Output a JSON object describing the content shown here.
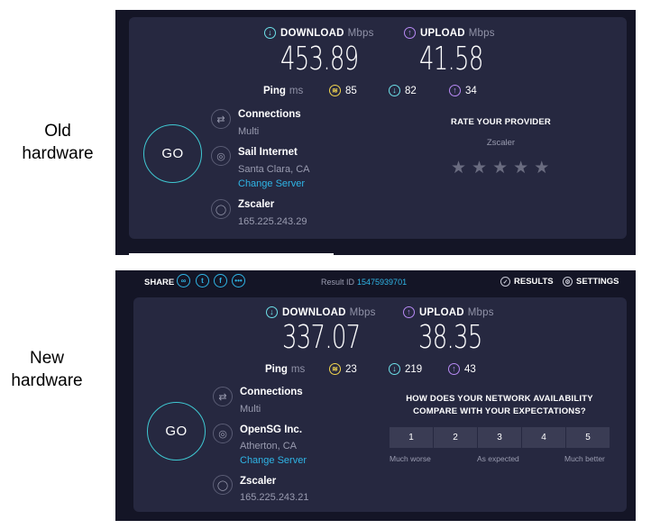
{
  "labels": {
    "old": [
      "Old",
      "hardware"
    ],
    "new": [
      "New",
      "hardware"
    ]
  },
  "colors": {
    "panel_bg": "#141526",
    "card_bg": "#262840",
    "download": "#6de0e8",
    "upload": "#b88af5",
    "jitter": "#f2d54e",
    "link": "#2fb5e6"
  },
  "old": {
    "download_label": "DOWNLOAD",
    "download_unit": "Mbps",
    "download_value": "453.89",
    "upload_label": "UPLOAD",
    "upload_unit": "Mbps",
    "upload_value": "41.58",
    "ping_label": "Ping",
    "ping_unit": "ms",
    "ping_jitter": "85",
    "ping_download": "82",
    "ping_upload": "34",
    "go_label": "GO",
    "connections_title": "Connections",
    "connections_value": "Multi",
    "server_name": "Sail Internet",
    "server_location": "Santa Clara, CA",
    "change_server": "Change Server",
    "isp_name": "Zscaler",
    "ip_address": "165.225.243.29",
    "rate_title": "RATE YOUR PROVIDER",
    "rate_provider": "Zscaler",
    "stars": 5
  },
  "new": {
    "share_label": "SHARE",
    "result_id_label": "Result ID",
    "result_id": "15475939701",
    "results_label": "RESULTS",
    "settings_label": "SETTINGS",
    "download_label": "DOWNLOAD",
    "download_unit": "Mbps",
    "download_value": "337.07",
    "upload_label": "UPLOAD",
    "upload_unit": "Mbps",
    "upload_value": "38.35",
    "ping_label": "Ping",
    "ping_unit": "ms",
    "ping_jitter": "23",
    "ping_download": "219",
    "ping_upload": "43",
    "go_label": "GO",
    "connections_title": "Connections",
    "connections_value": "Multi",
    "server_name": "OpenSG Inc.",
    "server_location": "Atherton, CA",
    "change_server": "Change Server",
    "isp_name": "Zscaler",
    "ip_address": "165.225.243.21",
    "question_line1": "HOW DOES YOUR NETWORK AVAILABILITY",
    "question_line2": "COMPARE WITH YOUR EXPECTATIONS?",
    "scale": [
      "1",
      "2",
      "3",
      "4",
      "5"
    ],
    "scale_low": "Much worse",
    "scale_mid": "As expected",
    "scale_high": "Much better"
  }
}
